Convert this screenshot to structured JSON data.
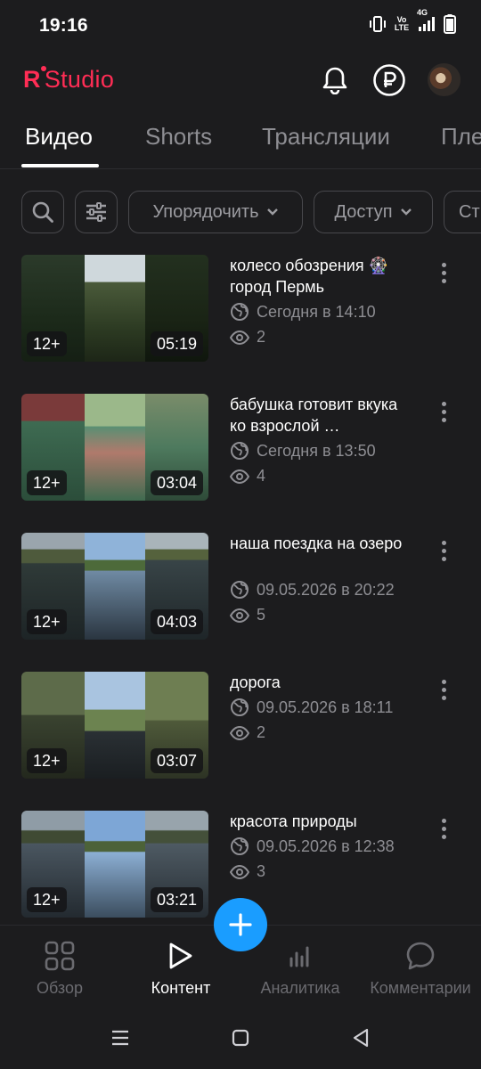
{
  "status_bar": {
    "time": "19:16",
    "network": "4G",
    "volte": "Vo LTE"
  },
  "header": {
    "logo_letter": "R",
    "logo_word": "Studio",
    "brand_color": "#ff2d55"
  },
  "tabs": [
    {
      "label": "Видео",
      "active": true
    },
    {
      "label": "Shorts",
      "active": false
    },
    {
      "label": "Трансляции",
      "active": false
    },
    {
      "label": "Пле",
      "active": false
    }
  ],
  "filters": {
    "sort_label": "Упорядочить",
    "access_label": "Доступ",
    "status_label": "Ст"
  },
  "videos": [
    {
      "title": "колесо обозрения 🎡 город Пермь",
      "date": "Сегодня в 14:10",
      "views": "2",
      "age": "12+",
      "duration": "05:19"
    },
    {
      "title": "бабушка готовит вкука ко взрослой …",
      "date": "Сегодня в 13:50",
      "views": "4",
      "age": "12+",
      "duration": "03:04"
    },
    {
      "title": "наша поездка на озеро",
      "date": "09.05.2026 в 20:22",
      "views": "5",
      "age": "12+",
      "duration": "04:03"
    },
    {
      "title": "дорога",
      "date": "09.05.2026 в 18:11",
      "views": "2",
      "age": "12+",
      "duration": "03:07"
    },
    {
      "title": "красота природы",
      "date": "09.05.2026 в 12:38",
      "views": "3",
      "age": "12+",
      "duration": "03:21"
    }
  ],
  "bottom_nav": [
    {
      "label": "Обзор",
      "icon": "grid-icon",
      "active": false
    },
    {
      "label": "Контент",
      "icon": "play-icon",
      "active": true
    },
    {
      "label": "Аналитика",
      "icon": "bar-chart-icon",
      "active": false
    },
    {
      "label": "Комментарии",
      "icon": "chat-bubble-icon",
      "active": false
    }
  ],
  "colors": {
    "background": "#1c1c1e",
    "fab": "#1a9dff",
    "muted_text": "#8e8e93"
  }
}
